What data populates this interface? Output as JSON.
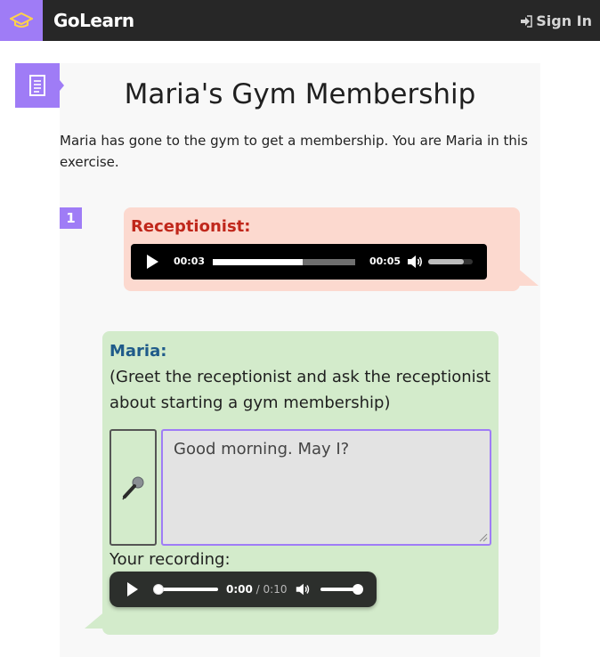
{
  "header": {
    "brand": "GoLearn",
    "signin_label": "Sign In"
  },
  "lesson": {
    "title": "Maria's Gym Membership",
    "intro": "Maria has gone to the gym to get a membership. You are Maria in this exercise.",
    "step_number": "1"
  },
  "receptionist": {
    "speaker": "Receptionist:",
    "audio": {
      "current_time": "00:03",
      "duration": "00:05",
      "progress": 0.63,
      "volume": 0.8
    }
  },
  "maria": {
    "speaker": "Maria:",
    "instruction": "(Greet the receptionist and ask the receptionist about starting a gym membership)",
    "answer_value": "Good morning. May I?",
    "recording_label": "Your recording:",
    "recording": {
      "current_time": "0:00",
      "separator": " / ",
      "duration": "0:10",
      "progress": 0.0,
      "volume": 1.0
    }
  },
  "colors": {
    "accent": "#9f7cf6",
    "receptionist_bubble": "#fcd9cf",
    "receptionist_name": "#c0271b",
    "maria_bubble": "#d3ebcb",
    "maria_name": "#1f5b8a"
  },
  "icons": {
    "logo": "graduation-cap-icon",
    "signin": "sign-in-icon",
    "doc_tab": "document-icon",
    "mic": "microphone-icon",
    "volume": "speaker-icon"
  }
}
